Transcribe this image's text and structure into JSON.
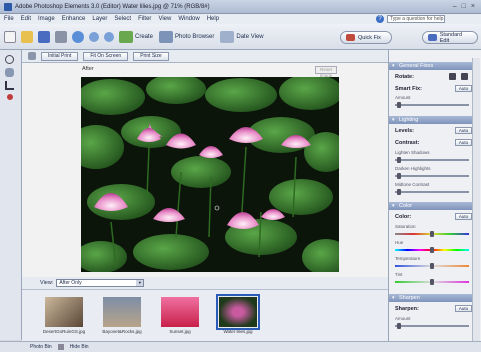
{
  "window": {
    "title": "Adobe Photoshop Elements 3.0 (Editor) Water lilies.jpg @ 71% (RGB/8#)",
    "controls": [
      "–",
      "□",
      "×"
    ]
  },
  "menu": {
    "items": [
      "File",
      "Edit",
      "Image",
      "Enhance",
      "Layer",
      "Select",
      "Filter",
      "View",
      "Window",
      "Help"
    ],
    "help_placeholder": "Type a question for help"
  },
  "toolbar": {
    "create_label": "Create",
    "photo_browser_label": "Photo Browser",
    "date_view_label": "Date View",
    "quick_fix_label": "Quick Fix",
    "standard_edit_label": "Standard Edit"
  },
  "options": {
    "initial_label": "Initial Print",
    "fit_label": "Fit On Screen",
    "print_label": "Print Size"
  },
  "canvas": {
    "after_label": "After",
    "reset_label": "Reset Image"
  },
  "view": {
    "label": "View:",
    "selected": "After Only"
  },
  "bin": {
    "items": [
      {
        "caption": "DesertGoRuinGS.jpg",
        "colors": [
          "#5a4636",
          "#cbb89c"
        ]
      },
      {
        "caption": "Bayonet&Rocks.jpg",
        "colors": [
          "#7e8ea6",
          "#b7a48a"
        ]
      },
      {
        "caption": "Sunset.jpg",
        "colors": [
          "#c8204a",
          "#f070a0"
        ]
      },
      {
        "caption": "Water lilies.jpg",
        "colors": [
          "#1e3a1a",
          "#c85aa0"
        ]
      }
    ]
  },
  "status": {
    "photo_bin": "Photo Bin",
    "options": "Hide Bin"
  },
  "panel": {
    "general": {
      "header": "General Fixes",
      "rotate": "Rotate:",
      "smart_fix": "Smart Fix:",
      "amount": "Amount",
      "auto": "Auto"
    },
    "lighting": {
      "header": "Lighting",
      "levels": "Levels:",
      "contrast": "Contrast:",
      "lighten": "Lighten Shadows",
      "darken": "Darken Highlights",
      "midtone": "Midtone Contrast",
      "auto": "Auto"
    },
    "color": {
      "header": "Color",
      "color_label": "Color:",
      "saturation": "Saturation",
      "hue": "Hue",
      "temperature": "Temperature",
      "tint": "Tint",
      "auto": "Auto"
    },
    "sharpen": {
      "header": "Sharpen",
      "sharpen_label": "Sharpen:",
      "amount": "Amount",
      "auto": "Auto"
    }
  }
}
